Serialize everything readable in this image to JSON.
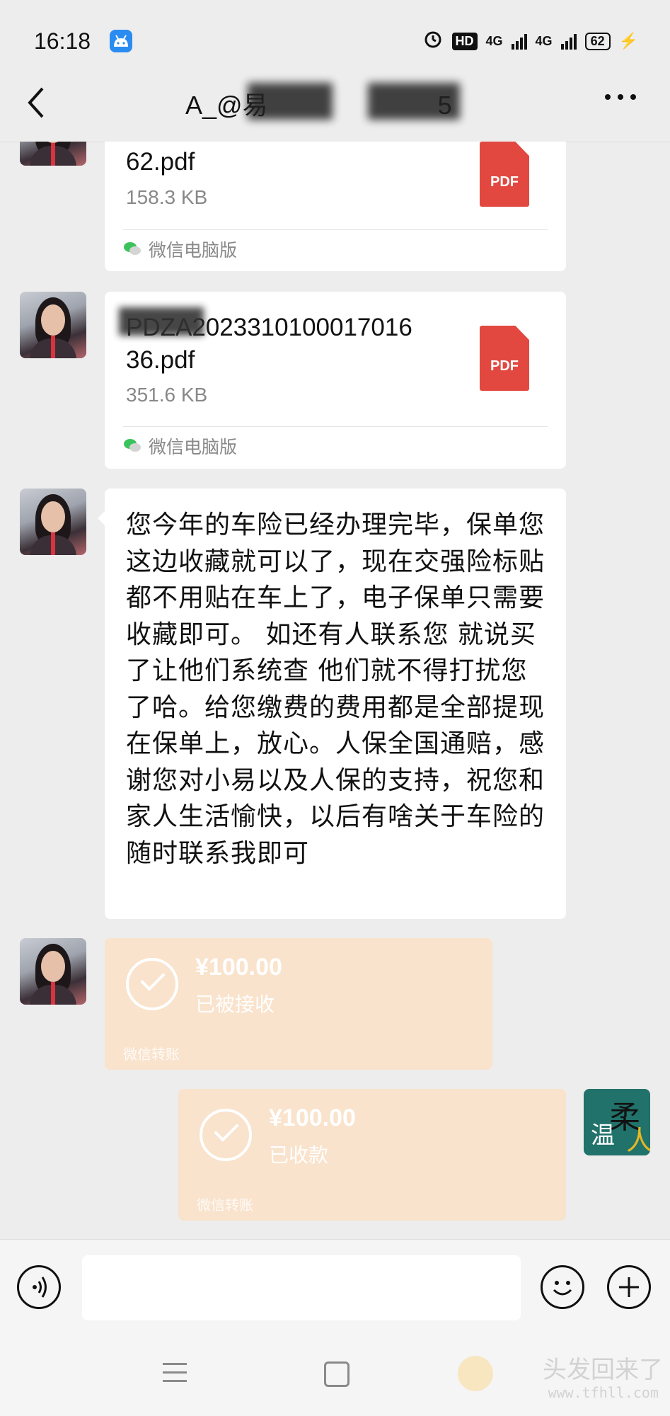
{
  "status_bar": {
    "time": "16:18",
    "hd": "HD",
    "net1": "4G",
    "net2": "4G",
    "battery": "62"
  },
  "header": {
    "title_start": "A_@易",
    "title_end": "5",
    "back_icon": "chevron-left-icon",
    "more_icon": "ellipsis-icon"
  },
  "messages": {
    "file1": {
      "name_tail": "62.pdf",
      "size": "158.3 KB",
      "icon_label": "PDF",
      "source": "微信电脑版"
    },
    "file2": {
      "name": "PDZA20233101000170163 6.pdf",
      "name_line1": "PDZA2023310100017016",
      "name_line2": "36.pdf",
      "size": "351.6 KB",
      "icon_label": "PDF",
      "source": "微信电脑版"
    },
    "text_message": "您今年的车险已经办理完毕，保单您这边收藏就可以了，现在交强险标贴都不用贴在车上了，电子保单只需要收藏即可。 如还有人联系您 就说买了让他们系统查 他们就不得打扰您了哈。给您缴费的费用都是全部提现在保单上，放心。人保全国通赔，感谢您对小易以及人保的支持，祝您和家人生活愉快，以后有啥关于车险的随时联系我即可",
    "transfer_in": {
      "amount": "¥100.00",
      "status": "已被接收",
      "label": "微信转账"
    },
    "transfer_out": {
      "amount": "¥100.00",
      "status": "已收款",
      "label": "微信转账"
    }
  },
  "my_avatar": {
    "char1": "温",
    "char2": "柔",
    "char3": "人"
  },
  "input_bar": {
    "value": "",
    "voice_icon": "voice-icon",
    "emoji_icon": "emoji-icon",
    "plus_icon": "plus-icon"
  },
  "watermark": {
    "text": "头发回来了",
    "url": "www.tfhll.com"
  },
  "colors": {
    "background": "#ededed",
    "bubble": "#ffffff",
    "pdf_red": "#e24840",
    "transfer_orange": "#f9e3cc",
    "wechat_green": "#3bc35b"
  }
}
